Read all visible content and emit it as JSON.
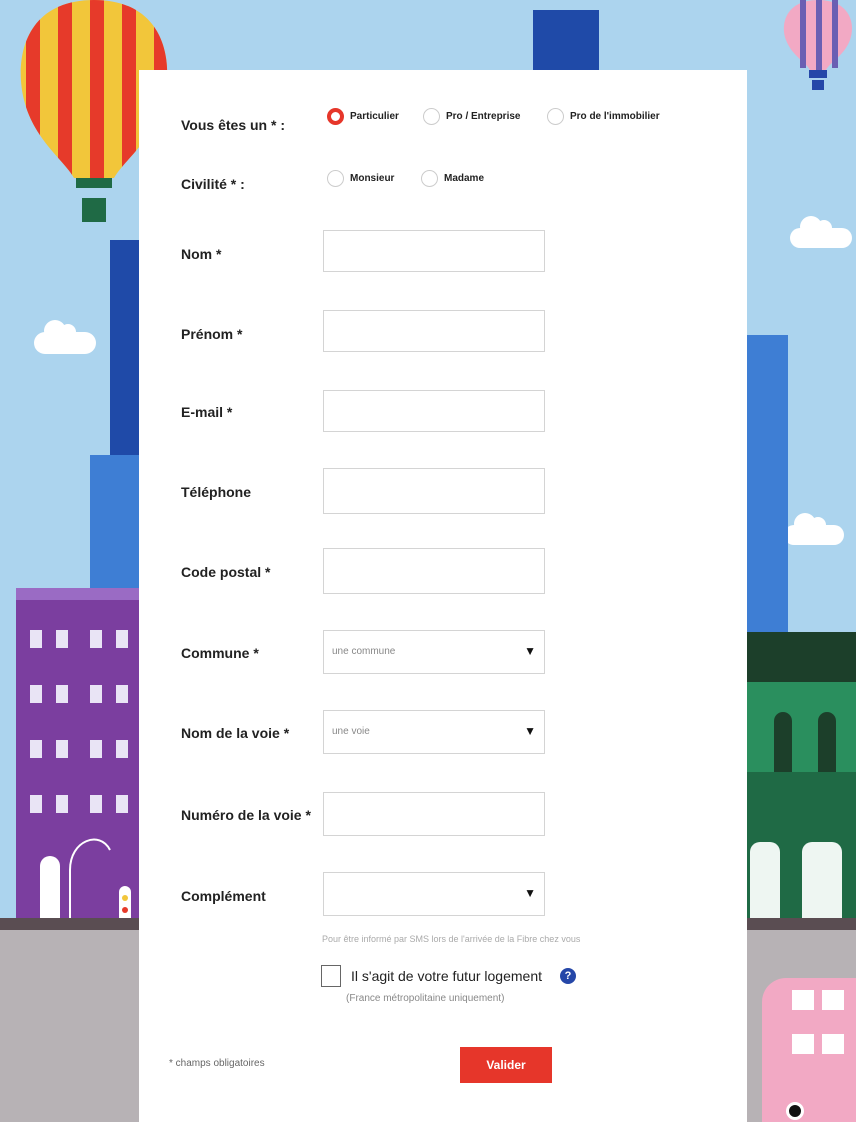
{
  "form": {
    "type_label": "Vous êtes un * :",
    "type_options": [
      "Particulier",
      "Pro / Entreprise",
      "Pro de l'immobilier"
    ],
    "type_selected": "Particulier",
    "civility_label": "Civilité * :",
    "civility_options": [
      "Monsieur",
      "Madame"
    ],
    "nom_label": "Nom *",
    "prenom_label": "Prénom *",
    "email_label": "E-mail *",
    "telephone_label": "Téléphone",
    "code_postal_label": "Code postal *",
    "commune_label": "Commune *",
    "commune_value": "une commune",
    "voie_label": "Nom de la voie *",
    "voie_value": "une voie",
    "numero_label": "Numéro de la voie *",
    "complement_label": "Complément",
    "sms_hint": "Pour être informé par SMS lors de l'arrivée de la Fibre chez vous",
    "checkbox_label": "Il s'agit de votre futur logement",
    "checkbox_sub": "(France métropolitaine uniquement)",
    "required_note": "* champs obligatoires",
    "submit_label": "Valider"
  },
  "icons": {
    "help": "question-circle-icon",
    "caret": "caret-down-icon"
  },
  "colors": {
    "accent": "#e6362a",
    "help": "#2547a8",
    "sky": "#acd4ee"
  }
}
